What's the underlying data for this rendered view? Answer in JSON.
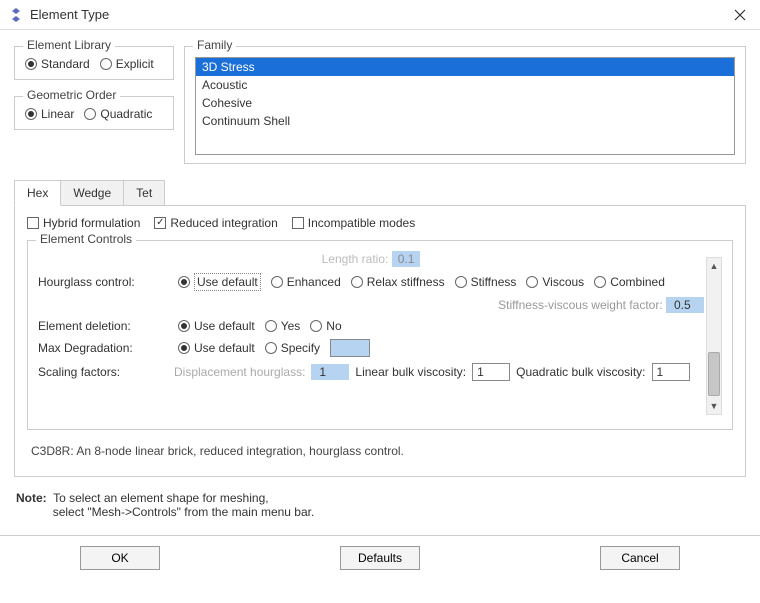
{
  "title": "Element Type",
  "element_library": {
    "label": "Element Library",
    "standard": "Standard",
    "explicit": "Explicit"
  },
  "geometric_order": {
    "label": "Geometric Order",
    "linear": "Linear",
    "quadratic": "Quadratic"
  },
  "family": {
    "label": "Family",
    "items": [
      "3D Stress",
      "Acoustic",
      "Cohesive",
      "Continuum Shell"
    ]
  },
  "tabs": {
    "hex": "Hex",
    "wedge": "Wedge",
    "tet": "Tet"
  },
  "checks": {
    "hybrid": "Hybrid formulation",
    "reduced": "Reduced integration",
    "incompat": "Incompatible modes"
  },
  "controls": {
    "label": "Element Controls",
    "length_ratio": "Length ratio:",
    "length_ratio_val": "0.1",
    "hourglass_label": "Hourglass control:",
    "opts": {
      "use_default": "Use default",
      "enhanced": "Enhanced",
      "relax": "Relax stiffness",
      "stiffness": "Stiffness",
      "viscous": "Viscous",
      "combined": "Combined",
      "yes": "Yes",
      "no": "No",
      "specify": "Specify"
    },
    "svwf_label": "Stiffness-viscous weight factor:",
    "svwf_val": "0.5",
    "del_label": "Element deletion:",
    "maxdeg_label": "Max Degradation:",
    "scaling_label": "Scaling factors:",
    "disp_hg": "Displacement hourglass:",
    "disp_hg_val": "1",
    "lbv": "Linear bulk viscosity:",
    "lbv_val": "1",
    "qbv": "Quadratic bulk viscosity:",
    "qbv_val": "1"
  },
  "description": "C3D8R:  An 8-node linear brick, reduced integration, hourglass control.",
  "note": {
    "prefix": "Note:",
    "line1": "To select an element shape for meshing,",
    "line2": "select \"Mesh->Controls\" from the main menu bar."
  },
  "buttons": {
    "ok": "OK",
    "defaults": "Defaults",
    "cancel": "Cancel"
  }
}
